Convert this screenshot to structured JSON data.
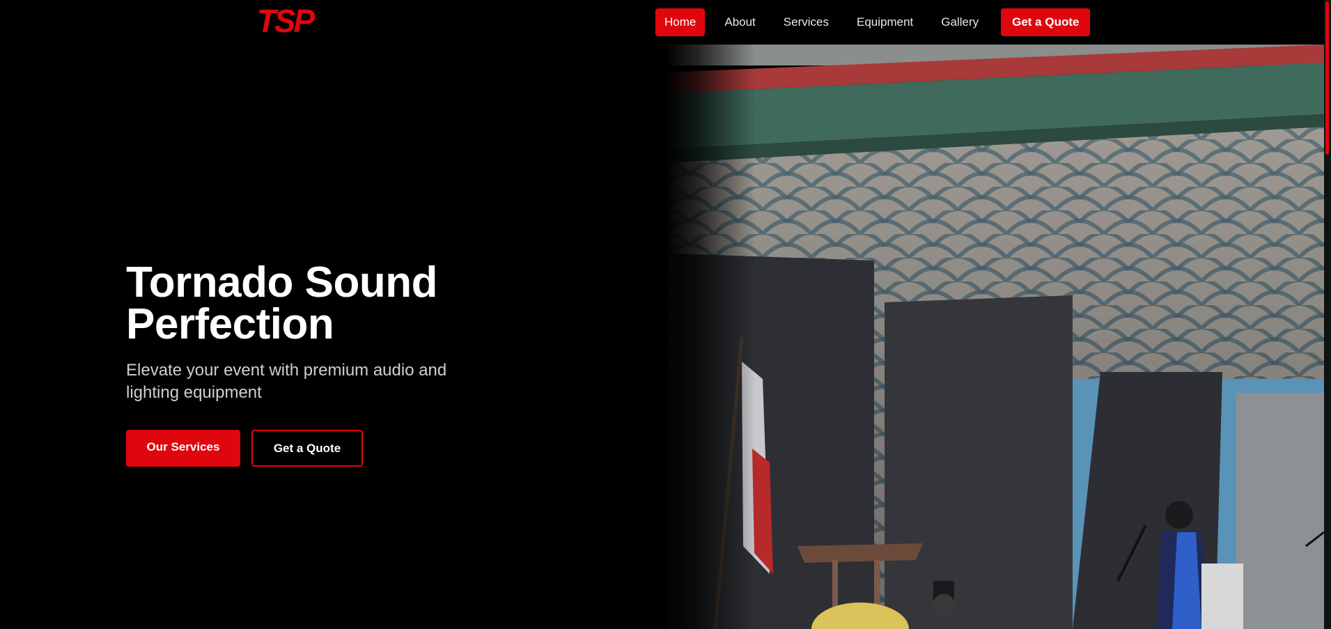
{
  "brand": {
    "logo_text": "TSP",
    "accent_color": "#e0060e"
  },
  "nav": {
    "items": [
      {
        "label": "Home",
        "active": true
      },
      {
        "label": "About",
        "active": false
      },
      {
        "label": "Services",
        "active": false
      },
      {
        "label": "Equipment",
        "active": false
      },
      {
        "label": "Gallery",
        "active": false
      }
    ],
    "cta_label": "Get a Quote"
  },
  "hero": {
    "title_line1": "Tornado Sound",
    "title_line2": "Perfection",
    "subtitle": "Elevate your event with premium audio and lighting equipment",
    "primary_button": "Our Services",
    "secondary_button": "Get a Quote",
    "image_icon": "stage-photo"
  }
}
